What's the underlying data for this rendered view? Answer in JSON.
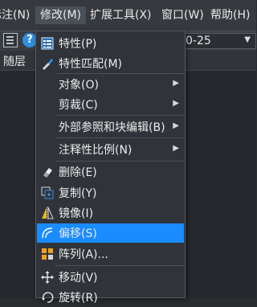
{
  "menubar": {
    "items": [
      {
        "label": "标注(N)"
      },
      {
        "label": "修改(M)"
      },
      {
        "label": "扩展工具(X)"
      },
      {
        "label": "窗口(W)"
      },
      {
        "label": "帮助(H)"
      }
    ]
  },
  "toolbar": {
    "combo_value": "0-25",
    "layer_label": "随层"
  },
  "dropdown": {
    "items": [
      {
        "label": "特性(P)",
        "icon": "properties-icon",
        "submenu": false
      },
      {
        "label": "特性匹配(M)",
        "icon": "match-properties-icon",
        "submenu": false
      },
      {
        "label": "对象(O)",
        "icon": "",
        "submenu": true
      },
      {
        "label": "剪裁(C)",
        "icon": "",
        "submenu": true
      },
      {
        "label": "外部参照和块编辑(B)",
        "icon": "",
        "submenu": true
      },
      {
        "label": "注释性比例(N)",
        "icon": "",
        "submenu": true
      },
      {
        "label": "删除(E)",
        "icon": "eraser-icon",
        "submenu": false
      },
      {
        "label": "复制(Y)",
        "icon": "copy-icon",
        "submenu": false
      },
      {
        "label": "镜像(I)",
        "icon": "mirror-icon",
        "submenu": false
      },
      {
        "label": "偏移(S)",
        "icon": "offset-icon",
        "submenu": false,
        "highlighted": true
      },
      {
        "label": "阵列(A)...",
        "icon": "array-icon",
        "submenu": false
      },
      {
        "label": "移动(V)",
        "icon": "move-icon",
        "submenu": false
      },
      {
        "label": "旋转(R)",
        "icon": "rotate-icon",
        "submenu": false
      }
    ]
  },
  "colors": {
    "highlight": "#1a8cff",
    "menu_bg": "#30343a",
    "menubar_bg": "#363a3f"
  }
}
